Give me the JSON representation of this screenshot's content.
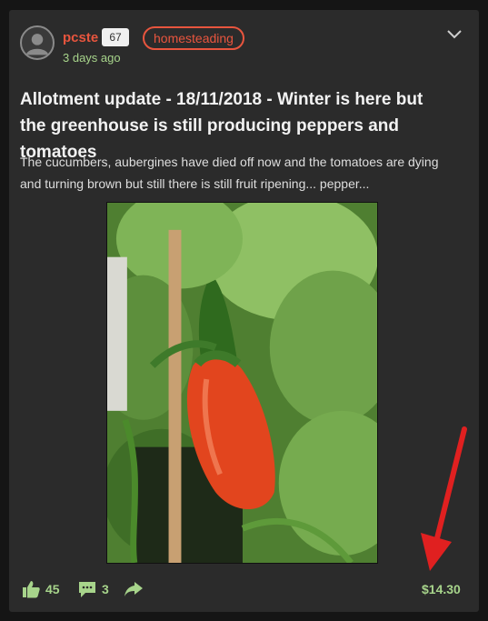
{
  "post": {
    "author": "pcste",
    "reputation": "67",
    "tag": "homesteading",
    "time": "3 days ago",
    "title": "Allotment update - 18/11/2018 - Winter is here but the greenhouse is still producing peppers and tomatoes",
    "excerpt": "The cucumbers, aubergines have died off now and the tomatoes are dying and turning brown but still there is still fruit ripening... pepper...",
    "upvotes": "45",
    "comments": "3",
    "payout": "$14.30"
  },
  "icons": {
    "menu": "chevron-down-icon",
    "upvote": "thumbs-up-icon",
    "comment": "comment-icon",
    "share": "share-icon",
    "annotation": "red-arrow"
  },
  "colors": {
    "card_bg": "#2b2b2b",
    "accent": "#e8553e",
    "green": "#a7d48b",
    "annotation": "#e02020"
  }
}
